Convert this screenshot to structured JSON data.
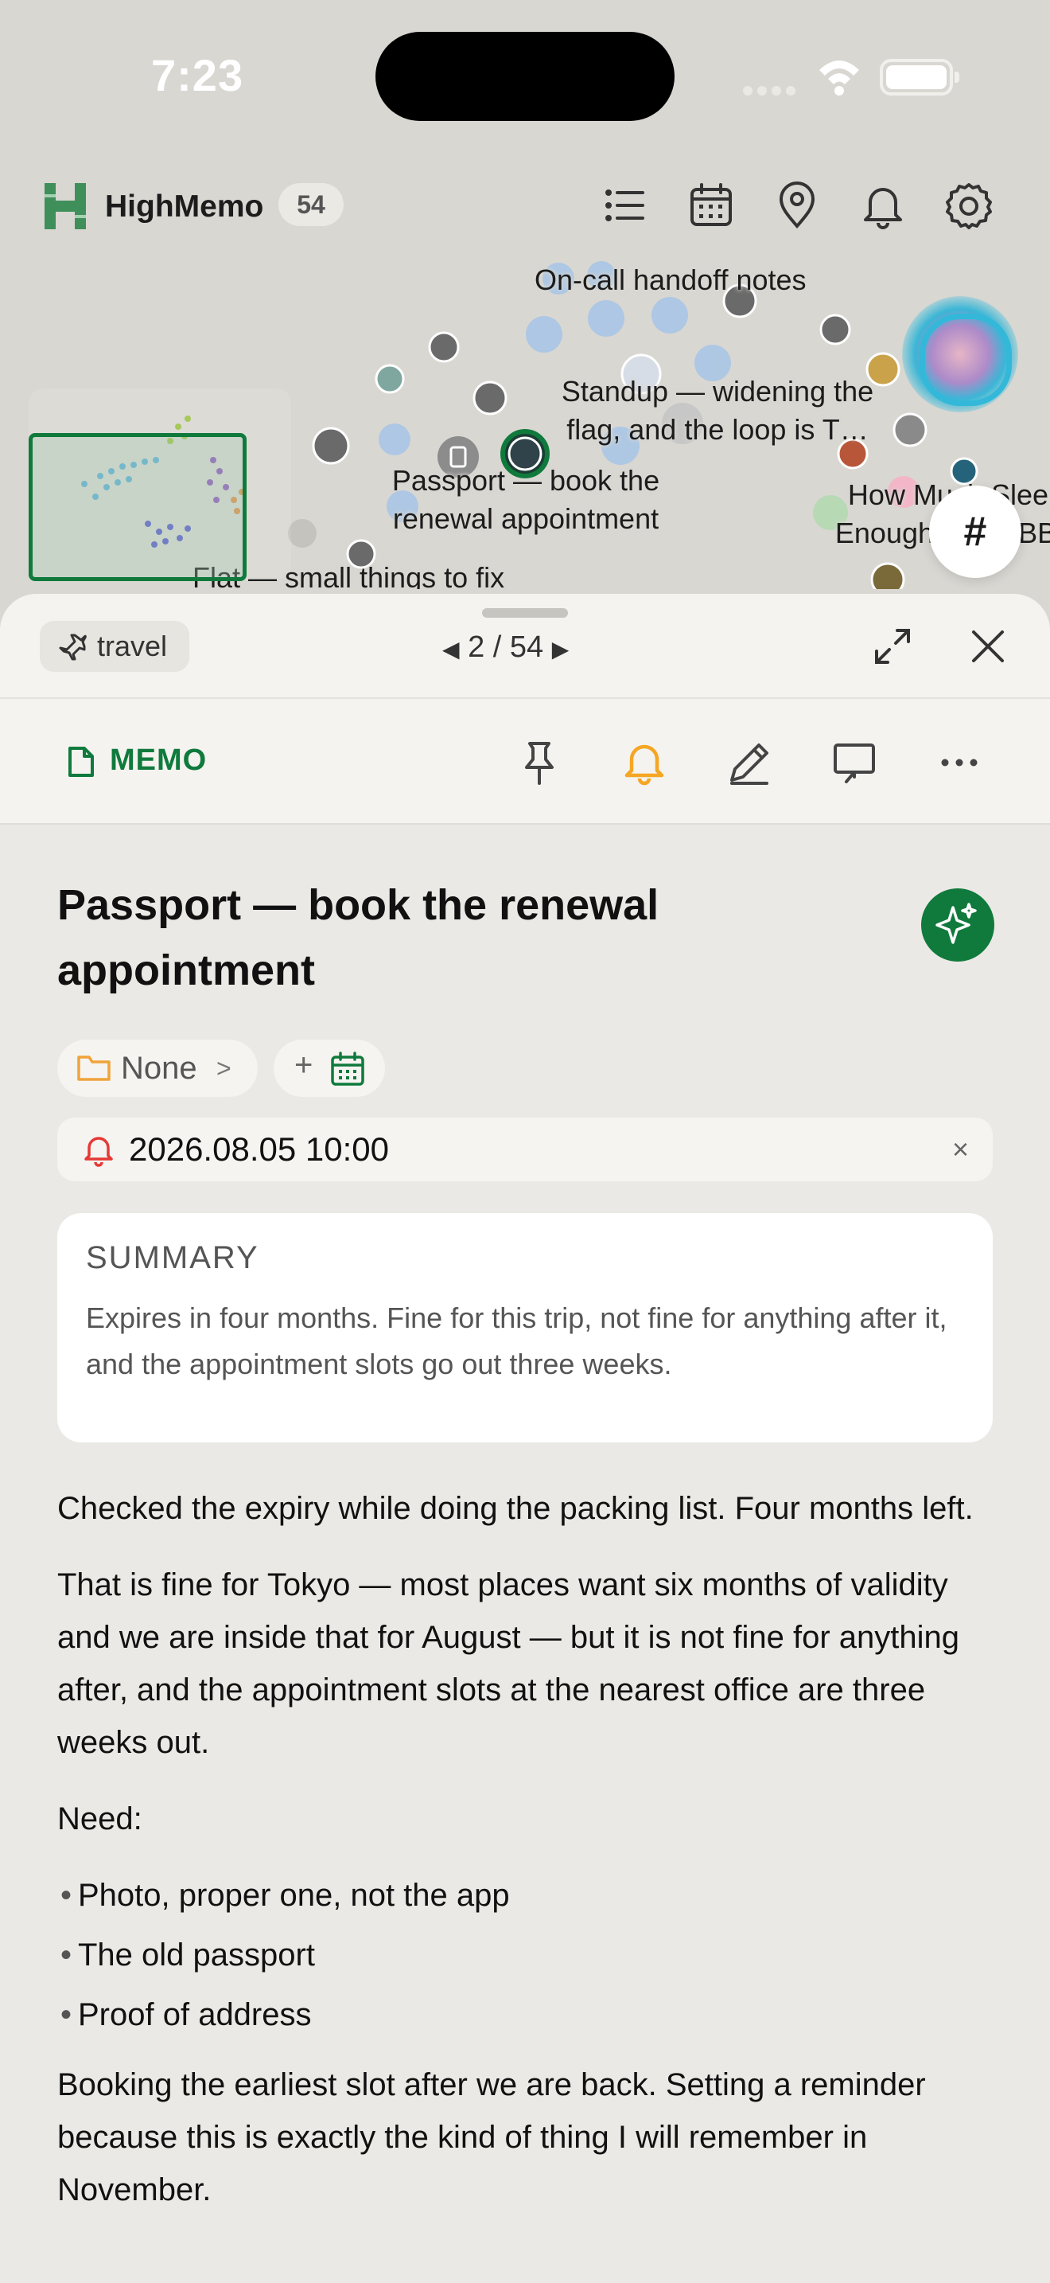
{
  "status": {
    "time": "7:23"
  },
  "header": {
    "app_name": "HighMemo",
    "count": "54"
  },
  "graph": {
    "labels": {
      "oncall": "On-call handoff notes",
      "standup": "Standup — widening the flag, and the loop is T…",
      "passport": "Passport — book the renewal appointment",
      "sleep": "How Much Sleep Enough? — A BBC",
      "flat": "Flat — small things to fix"
    },
    "fab_tag": "#"
  },
  "sheet": {
    "tag": "travel",
    "pager": {
      "prev": "◀",
      "position": "2 / 54",
      "next": "▶"
    },
    "type_label": "MEMO"
  },
  "memo": {
    "title": "Passport — book the renewal appointment",
    "folder": "None",
    "folder_chevron": ">",
    "add_date": "+",
    "reminder": "2026.08.05 10:00",
    "reminder_clear": "×",
    "summary_heading": "SUMMARY",
    "summary": "Expires in four months. Fine for this trip, not fine for anything after it, and the appointment slots go out three weeks.",
    "body": {
      "p1": "Checked the expiry while doing the packing list. Four months left.",
      "p2": "That is fine for Tokyo — most places want six months of validity and we are inside that for August — but it is not fine for anything after, and the appointment slots at the nearest office are three weeks out.",
      "p3": "Need:",
      "list": [
        "Photo, proper one, not the app",
        "The old passport",
        "Proof of address"
      ],
      "p4": "Booking the earliest slot after we are back. Setting a reminder because this is exactly the kind of thing I will remember in November."
    }
  },
  "colors": {
    "accent_green": "#0f7a3c",
    "bell_orange": "#f5a623",
    "bell_red": "#e53935",
    "folder_orange": "#f0a33a"
  }
}
